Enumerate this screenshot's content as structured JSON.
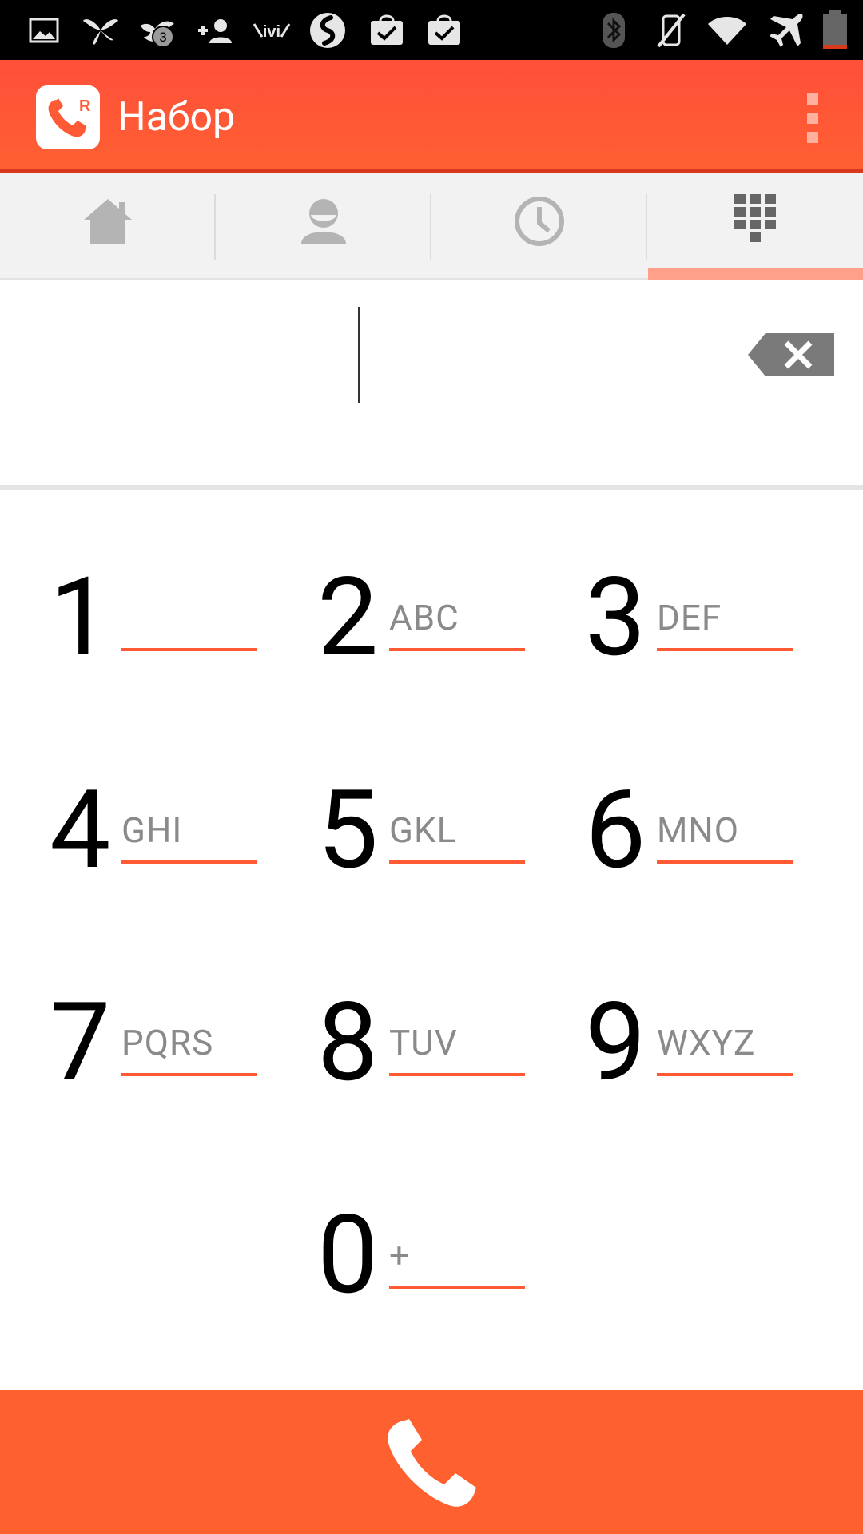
{
  "status_bar": {
    "icons": [
      "gallery-icon",
      "butterfly-icon",
      "bird-notification-icon",
      "add-contact-icon",
      "ivi-icon",
      "shazam-icon",
      "shopping-bag-check-icon",
      "shopping-bag-check-icon",
      "bluetooth-icon",
      "mute-icon",
      "wifi-icon",
      "airplane-icon",
      "battery-icon"
    ],
    "notification_count": "3"
  },
  "app_bar": {
    "title": "Набор",
    "logo_letter": "R",
    "accent_color": "#ff5a36"
  },
  "tabs": [
    {
      "name": "home",
      "icon": "home-icon",
      "active": false
    },
    {
      "name": "contacts",
      "icon": "contact-icon",
      "active": false
    },
    {
      "name": "history",
      "icon": "clock-icon",
      "active": false
    },
    {
      "name": "dialpad",
      "icon": "dialpad-icon",
      "active": true
    }
  ],
  "number_field": {
    "value": ""
  },
  "keypad": {
    "k1": {
      "digit": "1",
      "letters": ""
    },
    "k2": {
      "digit": "2",
      "letters": "ABC"
    },
    "k3": {
      "digit": "3",
      "letters": "DEF"
    },
    "k4": {
      "digit": "4",
      "letters": "GHI"
    },
    "k5": {
      "digit": "5",
      "letters": "GKL"
    },
    "k6": {
      "digit": "6",
      "letters": "MNO"
    },
    "k7": {
      "digit": "7",
      "letters": "PQRS"
    },
    "k8": {
      "digit": "8",
      "letters": "TUV"
    },
    "k9": {
      "digit": "9",
      "letters": "WXYZ"
    },
    "k0": {
      "digit": "0",
      "letters": "+"
    }
  },
  "colors": {
    "primary": "#ff5a36",
    "call_bar": "#ff602f",
    "tab_indicator": "#ffa18a",
    "status_bar": "#000000"
  }
}
